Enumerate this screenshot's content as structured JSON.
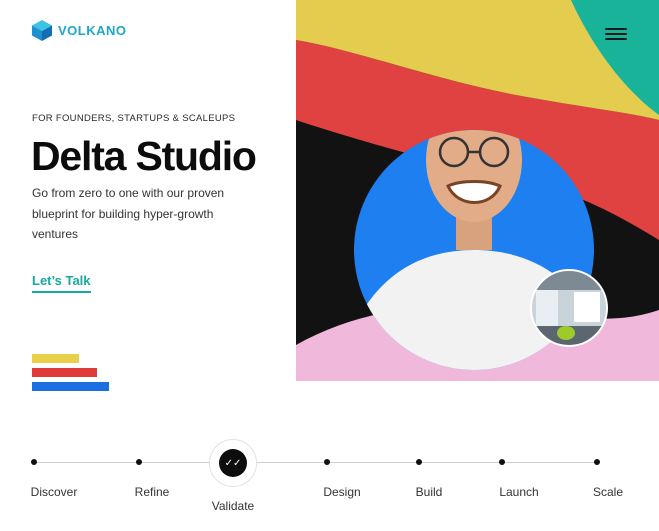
{
  "brand": {
    "name": "VOLKANO",
    "logo_color": "#1ea7c7"
  },
  "hero": {
    "eyebrow": "FOR FOUNDERS, STARTUPS & SCALEUPS",
    "title": "Delta Studio",
    "description": "Go from zero to one with our proven blueprint for building hyper-growth ventures",
    "cta_label": "Let’s Talk",
    "cta_color": "#17a9a0"
  },
  "decor_bars": [
    {
      "color": "#e8d04a"
    },
    {
      "color": "#e03b3b"
    },
    {
      "color": "#1b6fe0"
    }
  ],
  "header": {
    "menu_icon": "hamburger-menu-icon"
  },
  "timeline": {
    "steps": [
      {
        "label": "Discover"
      },
      {
        "label": "Refine"
      },
      {
        "label": "Validate",
        "active": true
      },
      {
        "label": "Design"
      },
      {
        "label": "Build"
      },
      {
        "label": "Launch"
      },
      {
        "label": "Scale"
      }
    ],
    "active_icon": "double-check-icon"
  },
  "palette": {
    "yellow": "#e4cc4e",
    "red": "#e04242",
    "black": "#121212",
    "blue": "#1e7ff0",
    "teal": "#19b39a",
    "pink": "#f0b9dc"
  }
}
